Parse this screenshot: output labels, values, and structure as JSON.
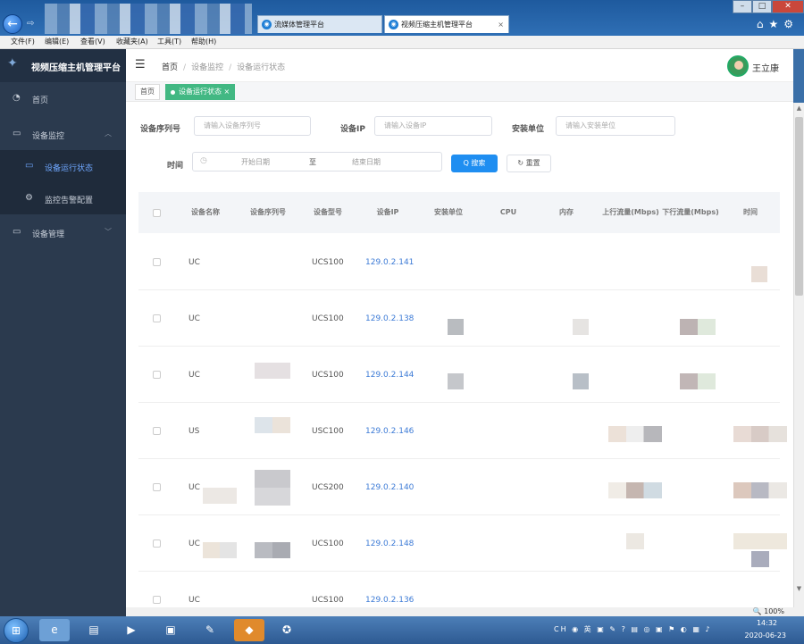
{
  "browser": {
    "tabs": [
      {
        "label": "流媒体管理平台",
        "active": false
      },
      {
        "label": "视频压缩主机管理平台",
        "active": true
      }
    ],
    "menu": [
      "文件(F)",
      "编辑(E)",
      "查看(V)",
      "收藏夹(A)",
      "工具(T)",
      "帮助(H)"
    ],
    "tab_close": "×"
  },
  "sidebar": {
    "title": "视频压缩主机管理平台",
    "items": [
      {
        "label": "首页",
        "icon": "dashboard-icon"
      },
      {
        "label": "设备监控",
        "icon": "monitor-icon"
      },
      {
        "label": "设备运行状态",
        "icon": "monitor-icon"
      },
      {
        "label": "监控告警配置",
        "icon": "gear-icon"
      },
      {
        "label": "设备管理",
        "icon": "monitor-icon"
      }
    ]
  },
  "header": {
    "breadcrumb": [
      "首页",
      "设备监控",
      "设备运行状态"
    ],
    "username": "王立康"
  },
  "page_tabs": [
    {
      "label": "首页"
    },
    {
      "label": "设备运行状态"
    }
  ],
  "filters": {
    "serial_label": "设备序列号",
    "serial_placeholder": "请输入设备序列号",
    "ip_label": "设备IP",
    "ip_placeholder": "请输入设备IP",
    "unit_label": "安装单位",
    "unit_placeholder": "请输入安装单位",
    "time_label": "时间",
    "start_placeholder": "开始日期",
    "range_sep": "至",
    "end_placeholder": "结束日期",
    "search_label": "Q 搜索",
    "reset_label": "↻ 重置"
  },
  "table": {
    "columns": [
      "设备名称",
      "设备序列号",
      "设备型号",
      "设备IP",
      "安装单位",
      "CPU",
      "内存",
      "上行流量(Mbps)",
      "下行流量(Mbps)",
      "时间"
    ],
    "rows": [
      {
        "name": "UC",
        "model": "UCS100",
        "ip": "129.0.2.141"
      },
      {
        "name": "UC",
        "model": "UCS100",
        "ip": "129.0.2.138"
      },
      {
        "name": "UC",
        "model": "UCS100",
        "ip": "129.0.2.144"
      },
      {
        "name": "US",
        "model": "USC100",
        "ip": "129.0.2.146"
      },
      {
        "name": "UC",
        "model": "UCS200",
        "ip": "129.0.2.140"
      },
      {
        "name": "UC",
        "model": "UCS100",
        "ip": "129.0.2.148"
      },
      {
        "name": "UC",
        "model": "UCS100",
        "ip": "129.0.2.136"
      }
    ]
  },
  "status": {
    "zoom": "100%"
  },
  "taskbar": {
    "time": "14:32",
    "date": "2020-06-23",
    "lang": "CH"
  }
}
